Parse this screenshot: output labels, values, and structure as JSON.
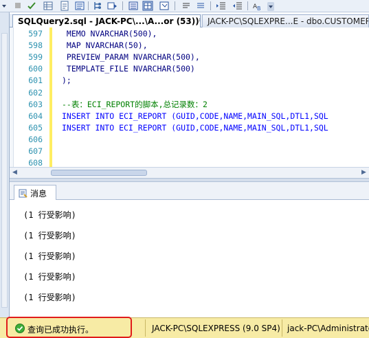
{
  "tabs": [
    {
      "label": "SQLQuery2.sql - JACK-PC\\...\\A...or (53))*",
      "active": true
    },
    {
      "label": "JACK-PC\\SQLEXPRE...E - dbo.CUSTOMER",
      "active": false
    }
  ],
  "editor": {
    "lines": [
      {
        "num": "597",
        "text": " MEMO NVARCHAR(500),",
        "kind": "plain"
      },
      {
        "num": "598",
        "text": " MAP NVARCHAR(50),",
        "kind": "plain"
      },
      {
        "num": "599",
        "text": " PREVIEW_PARAM NVARCHAR(500),",
        "kind": "plain"
      },
      {
        "num": "600",
        "text": " TEMPLATE_FILE NVARCHAR(500)",
        "kind": "plain"
      },
      {
        "num": "601",
        "text": ");",
        "kind": "plain"
      },
      {
        "num": "602",
        "text": "",
        "kind": "plain"
      },
      {
        "num": "603",
        "text": "--表：ECI_REPORT的脚本,总记录数：2",
        "kind": "comment"
      },
      {
        "num": "604",
        "text": "INSERT INTO ECI_REPORT (GUID,CODE,NAME,MAIN_SQL,DTL1,SQL",
        "kind": "keyword"
      },
      {
        "num": "605",
        "text": "INSERT INTO ECI_REPORT (GUID,CODE,NAME,MAIN_SQL,DTL1,SQL",
        "kind": "keyword"
      },
      {
        "num": "606",
        "text": "",
        "kind": "plain"
      },
      {
        "num": "607",
        "text": "",
        "kind": "plain"
      },
      {
        "num": "608",
        "text": "",
        "kind": "plain"
      }
    ]
  },
  "results": {
    "tab_label": "消息",
    "messages": [
      "(1 行受影响)",
      "(1 行受影响)",
      "(1 行受影响)",
      "(1 行受影响)",
      "(1 行受影响)"
    ]
  },
  "status_bar": {
    "message": "查询已成功执行。",
    "server": "JACK-PC\\SQLEXPRESS (9.0 SP4)",
    "user": "jack-PC\\Administrator"
  },
  "colors": {
    "status_bg": "#f7eba5",
    "highlight_box": "#e01b1b",
    "line_numbers": "#2b91af",
    "keyword": "#0000ff",
    "comment": "#008000",
    "change_bar": "#ffee62"
  },
  "toolbar_icons": [
    "dropdown-arrow-icon",
    "stop-icon",
    "check-icon",
    "results-grid-icon",
    "results-file-icon",
    "parse-icon",
    "display-plan-icon",
    "include-plan-icon",
    "results-text-icon",
    "results-grid-icon",
    "comment-icon",
    "uncomment-icon",
    "indent-icon",
    "outdent-icon",
    "specify-values-icon",
    "toolbar-overflow-icon"
  ]
}
